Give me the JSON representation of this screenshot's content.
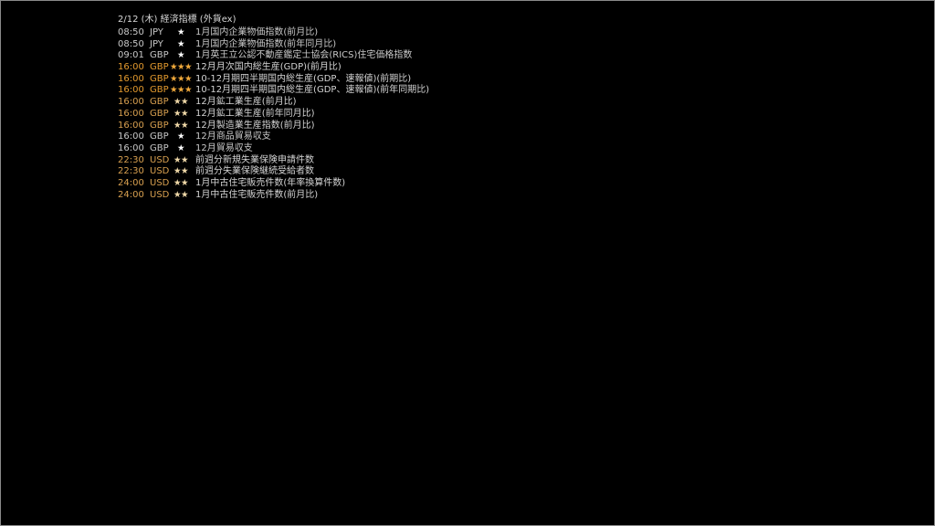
{
  "header": {
    "title": "2/12 (木) 経済指標 (外貨ex)"
  },
  "colors": {
    "normal_time": "#c8c8c8",
    "two_star_time": "#d8a050",
    "three_star_time": "#e49a2e",
    "three_star_icon": "#f0a93b"
  },
  "events": [
    {
      "time": "08:50",
      "currency": "JPY",
      "stars": "★",
      "title": "1月国内企業物価指数(前月比)"
    },
    {
      "time": "08:50",
      "currency": "JPY",
      "stars": "★",
      "title": "1月国内企業物価指数(前年同月比)"
    },
    {
      "time": "09:01",
      "currency": "GBP",
      "stars": "★",
      "title": "1月英王立公認不動産鑑定士協会(RICS)住宅価格指数"
    },
    {
      "time": "16:00",
      "currency": "GBP",
      "stars": "★★★",
      "title": "12月月次国内総生産(GDP)(前月比)"
    },
    {
      "time": "16:00",
      "currency": "GBP",
      "stars": "★★★",
      "title": "10-12月期四半期国内総生産(GDP、速報値)(前期比)"
    },
    {
      "time": "16:00",
      "currency": "GBP",
      "stars": "★★★",
      "title": "10-12月期四半期国内総生産(GDP、速報値)(前年同期比)"
    },
    {
      "time": "16:00",
      "currency": "GBP",
      "stars": "★★",
      "title": "12月鉱工業生産(前月比)"
    },
    {
      "time": "16:00",
      "currency": "GBP",
      "stars": "★★",
      "title": "12月鉱工業生産(前年同月比)"
    },
    {
      "time": "16:00",
      "currency": "GBP",
      "stars": "★★",
      "title": "12月製造業生産指数(前月比)"
    },
    {
      "time": "16:00",
      "currency": "GBP",
      "stars": "★",
      "title": "12月商品貿易収支"
    },
    {
      "time": "16:00",
      "currency": "GBP",
      "stars": "★",
      "title": "12月貿易収支"
    },
    {
      "time": "22:30",
      "currency": "USD",
      "stars": "★★",
      "title": "前週分新規失業保険申請件数"
    },
    {
      "time": "22:30",
      "currency": "USD",
      "stars": "★★",
      "title": "前週分失業保険継続受給者数"
    },
    {
      "time": "24:00",
      "currency": "USD",
      "stars": "★★",
      "title": "1月中古住宅販売件数(年率換算件数)"
    },
    {
      "time": "24:00",
      "currency": "USD",
      "stars": "★★",
      "title": "1月中古住宅販売件数(前月比)"
    }
  ]
}
